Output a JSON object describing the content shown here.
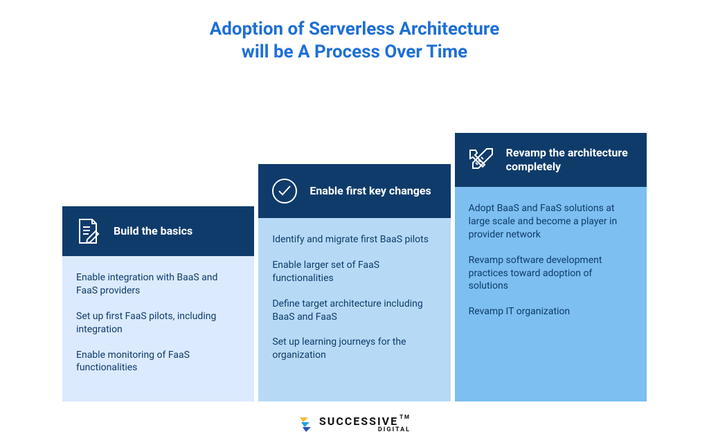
{
  "title_line1": "Adoption of Serverless Architecture",
  "title_line2": "will be A Process Over Time",
  "colors": {
    "title": "#1d6fd6",
    "header_bg": "#0f3b6b",
    "body_text": "#0f3b6b",
    "step1_bg": "#dbeafe",
    "step2_bg": "#b6daf6",
    "step3_bg": "#7cbff0"
  },
  "steps": [
    {
      "icon": "document-pencil-icon",
      "label": "Build the basics",
      "items": [
        "Enable integration with BaaS and FaaS providers",
        "Set up first FaaS pilots, including integration",
        "Enable monitoring of FaaS functionalities"
      ]
    },
    {
      "icon": "circle-check-icon",
      "label": "Enable first key changes",
      "items": [
        "Identify and migrate first BaaS pilots",
        "Enable larger set of FaaS functionalities",
        "Define target architecture including BaaS and FaaS",
        "Set up learning journeys for the organization"
      ]
    },
    {
      "icon": "hammer-ruler-icon",
      "label": "Revamp the architecture completely",
      "items": [
        "Adopt BaaS and FaaS solutions at large scale and become a player in provider network",
        "Revamp software development practices toward adoption of solutions",
        "Revamp IT organization"
      ]
    }
  ],
  "brand": {
    "name": "SUCCESSIVE",
    "sub": "DIGITAL",
    "tm": "TM",
    "mark_colors": [
      "#f6b83c",
      "#1aa2dc",
      "#2752b6"
    ]
  }
}
